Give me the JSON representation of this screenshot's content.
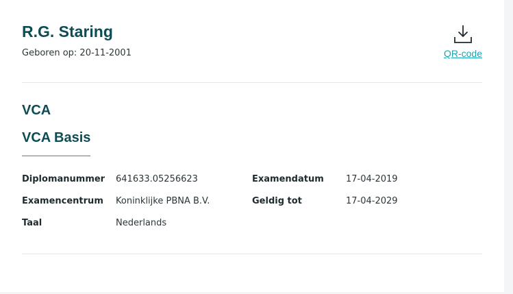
{
  "person": {
    "name": "R.G. Staring",
    "dob": "Geboren op: 20-11-2001"
  },
  "qr": {
    "icon": "download-icon",
    "label": "QR-code"
  },
  "certificate": {
    "category": "VCA",
    "diploma": "VCA Basis",
    "fields": {
      "diplomanummer_label": "Diplomanummer",
      "diplomanummer_value": "641633.05256623",
      "examencentrum_label": "Examencentrum",
      "examencentrum_value": "Koninklijke PBNA B.V.",
      "taal_label": "Taal",
      "taal_value": "Nederlands",
      "examendatum_label": "Examendatum",
      "examendatum_value": "17-04-2019",
      "geldig_label": "Geldig tot",
      "geldig_value": "17-04-2029"
    }
  },
  "colors": {
    "heading": "#0d4b55",
    "link": "#1aa3b0",
    "accent_underline": "#3f9a3c"
  }
}
